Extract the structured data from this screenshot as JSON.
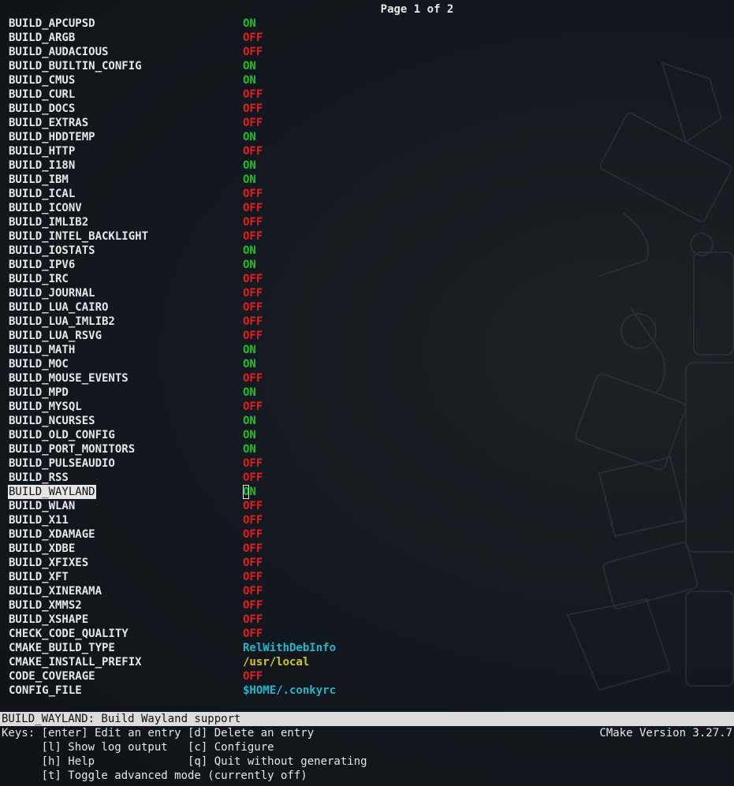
{
  "page_indicator": "Page 1 of 2",
  "entries": [
    {
      "name": "BUILD_APCUPSD",
      "value": "ON",
      "kind": "on"
    },
    {
      "name": "BUILD_ARGB",
      "value": "OFF",
      "kind": "off"
    },
    {
      "name": "BUILD_AUDACIOUS",
      "value": "OFF",
      "kind": "off"
    },
    {
      "name": "BUILD_BUILTIN_CONFIG",
      "value": "ON",
      "kind": "on"
    },
    {
      "name": "BUILD_CMUS",
      "value": "ON",
      "kind": "on"
    },
    {
      "name": "BUILD_CURL",
      "value": "OFF",
      "kind": "off"
    },
    {
      "name": "BUILD_DOCS",
      "value": "OFF",
      "kind": "off"
    },
    {
      "name": "BUILD_EXTRAS",
      "value": "OFF",
      "kind": "off"
    },
    {
      "name": "BUILD_HDDTEMP",
      "value": "ON",
      "kind": "on"
    },
    {
      "name": "BUILD_HTTP",
      "value": "OFF",
      "kind": "off"
    },
    {
      "name": "BUILD_I18N",
      "value": "ON",
      "kind": "on"
    },
    {
      "name": "BUILD_IBM",
      "value": "ON",
      "kind": "on"
    },
    {
      "name": "BUILD_ICAL",
      "value": "OFF",
      "kind": "off"
    },
    {
      "name": "BUILD_ICONV",
      "value": "OFF",
      "kind": "off"
    },
    {
      "name": "BUILD_IMLIB2",
      "value": "OFF",
      "kind": "off"
    },
    {
      "name": "BUILD_INTEL_BACKLIGHT",
      "value": "OFF",
      "kind": "off"
    },
    {
      "name": "BUILD_IOSTATS",
      "value": "ON",
      "kind": "on"
    },
    {
      "name": "BUILD_IPV6",
      "value": "ON",
      "kind": "on"
    },
    {
      "name": "BUILD_IRC",
      "value": "OFF",
      "kind": "off"
    },
    {
      "name": "BUILD_JOURNAL",
      "value": "OFF",
      "kind": "off"
    },
    {
      "name": "BUILD_LUA_CAIRO",
      "value": "OFF",
      "kind": "off"
    },
    {
      "name": "BUILD_LUA_IMLIB2",
      "value": "OFF",
      "kind": "off"
    },
    {
      "name": "BUILD_LUA_RSVG",
      "value": "OFF",
      "kind": "off"
    },
    {
      "name": "BUILD_MATH",
      "value": "ON",
      "kind": "on"
    },
    {
      "name": "BUILD_MOC",
      "value": "ON",
      "kind": "on"
    },
    {
      "name": "BUILD_MOUSE_EVENTS",
      "value": "OFF",
      "kind": "off"
    },
    {
      "name": "BUILD_MPD",
      "value": "ON",
      "kind": "on"
    },
    {
      "name": "BUILD_MYSQL",
      "value": "OFF",
      "kind": "off"
    },
    {
      "name": "BUILD_NCURSES",
      "value": "ON",
      "kind": "on"
    },
    {
      "name": "BUILD_OLD_CONFIG",
      "value": "ON",
      "kind": "on"
    },
    {
      "name": "BUILD_PORT_MONITORS",
      "value": "ON",
      "kind": "on"
    },
    {
      "name": "BUILD_PULSEAUDIO",
      "value": "OFF",
      "kind": "off"
    },
    {
      "name": "BUILD_RSS",
      "value": "OFF",
      "kind": "off"
    },
    {
      "name": "BUILD_WAYLAND",
      "value": "ON",
      "kind": "on",
      "selected": true
    },
    {
      "name": "BUILD_WLAN",
      "value": "OFF",
      "kind": "off"
    },
    {
      "name": "BUILD_X11",
      "value": "OFF",
      "kind": "off"
    },
    {
      "name": "BUILD_XDAMAGE",
      "value": "OFF",
      "kind": "off"
    },
    {
      "name": "BUILD_XDBE",
      "value": "OFF",
      "kind": "off"
    },
    {
      "name": "BUILD_XFIXES",
      "value": "OFF",
      "kind": "off"
    },
    {
      "name": "BUILD_XFT",
      "value": "OFF",
      "kind": "off"
    },
    {
      "name": "BUILD_XINERAMA",
      "value": "OFF",
      "kind": "off"
    },
    {
      "name": "BUILD_XMMS2",
      "value": "OFF",
      "kind": "off"
    },
    {
      "name": "BUILD_XSHAPE",
      "value": "OFF",
      "kind": "off"
    },
    {
      "name": "CHECK_CODE_QUALITY",
      "value": "OFF",
      "kind": "off"
    },
    {
      "name": "CMAKE_BUILD_TYPE",
      "value": "RelWithDebInfo",
      "kind": "str"
    },
    {
      "name": "CMAKE_INSTALL_PREFIX",
      "value": "/usr/local",
      "kind": "path"
    },
    {
      "name": "CODE_COVERAGE",
      "value": "OFF",
      "kind": "off"
    },
    {
      "name": "CONFIG_FILE",
      "value": "$HOME/.conkyrc",
      "kind": "str"
    }
  ],
  "help_text": "BUILD_WAYLAND: Build Wayland support",
  "keys": {
    "line1": "Keys: [enter] Edit an entry [d] Delete an entry",
    "line2": "      [l] Show log output   [c] Configure",
    "line3": "      [h] Help              [q] Quit without generating",
    "line4": "      [t] Toggle advanced mode (currently off)"
  },
  "version": "CMake Version 3.27.7",
  "colors": {
    "on": "#18c21e",
    "off": "#e21e1e",
    "string": "#1fb8c7",
    "path": "#d8c41a",
    "background": "#12161b",
    "statusbar": "#dcdcdc"
  }
}
